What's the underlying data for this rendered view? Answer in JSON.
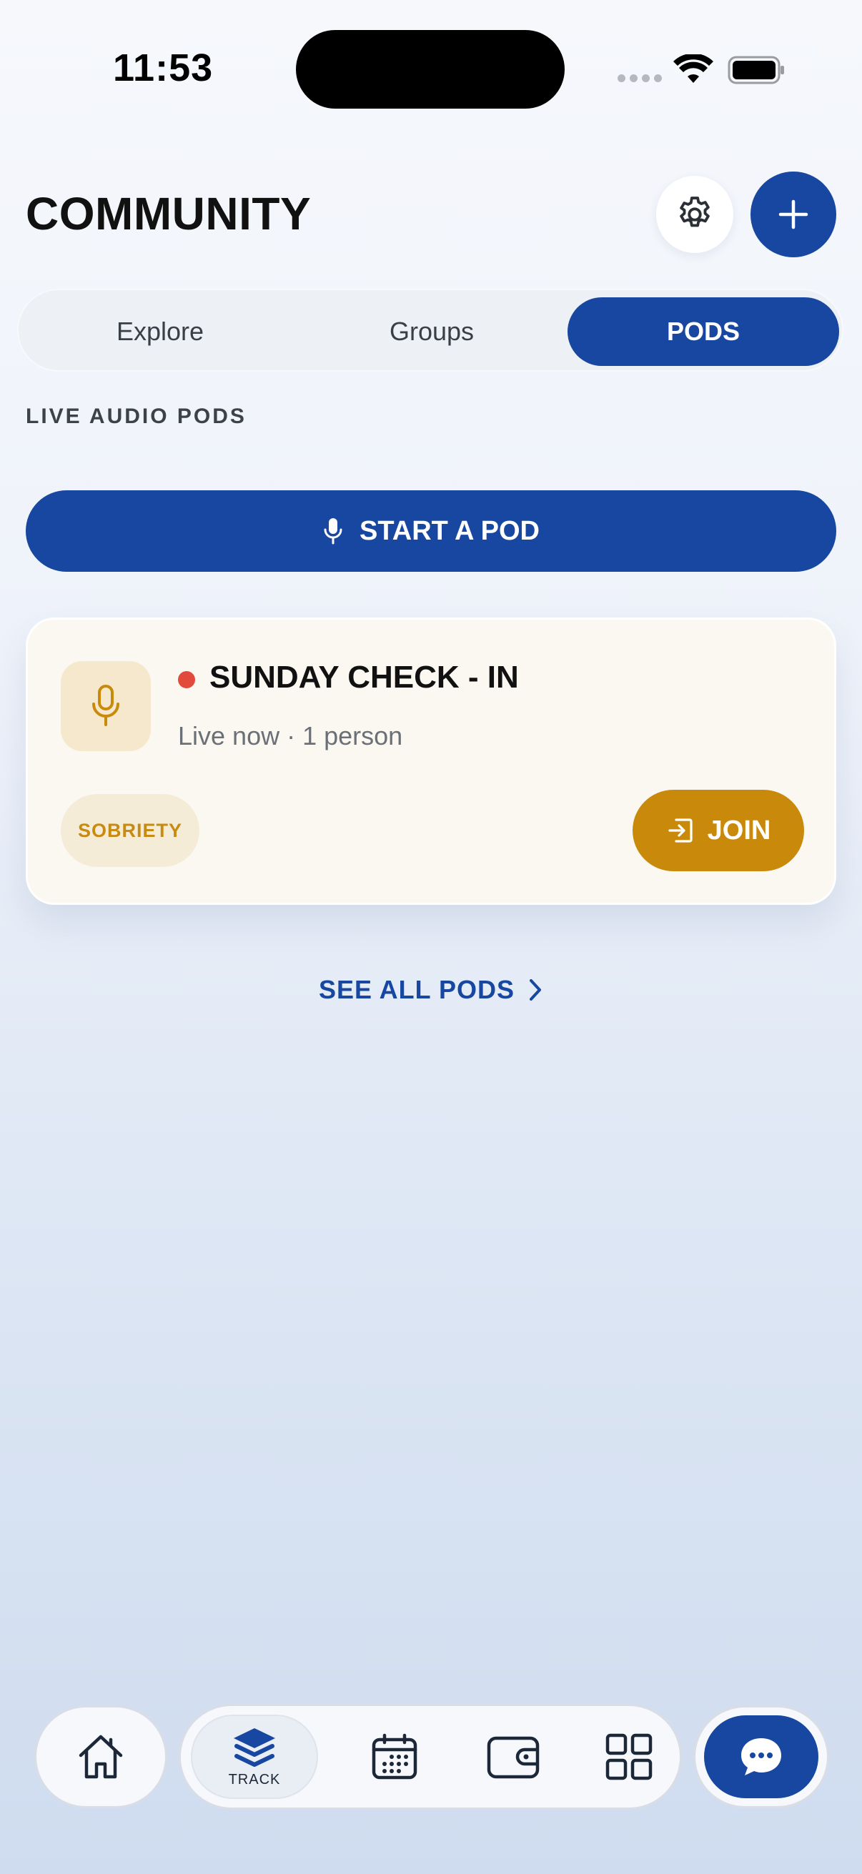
{
  "status_bar": {
    "time": "11:53"
  },
  "header": {
    "title": "COMMUNITY"
  },
  "tabs": [
    {
      "label": "Explore",
      "active": false
    },
    {
      "label": "Groups",
      "active": false
    },
    {
      "label": "PODS",
      "active": true
    }
  ],
  "section_label": "LIVE AUDIO PODS",
  "start_pod": {
    "label": "START A POD",
    "icon": "microphone-icon"
  },
  "pod": {
    "title": "SUNDAY CHECK - IN",
    "subtitle": "Live now · 1 person",
    "tag": "SOBRIETY",
    "join_label": "JOIN",
    "status_color": "#e24b3b"
  },
  "see_all": {
    "label": "SEE ALL PODS"
  },
  "bottom_nav": {
    "items": [
      "home-icon",
      "track-icon",
      "calendar-icon",
      "wallet-icon",
      "grid-icon",
      "chat-icon"
    ],
    "track_label": "TRACK"
  },
  "colors": {
    "primary": "#1747a0",
    "accent": "#c98a0b",
    "live": "#e24b3b"
  }
}
